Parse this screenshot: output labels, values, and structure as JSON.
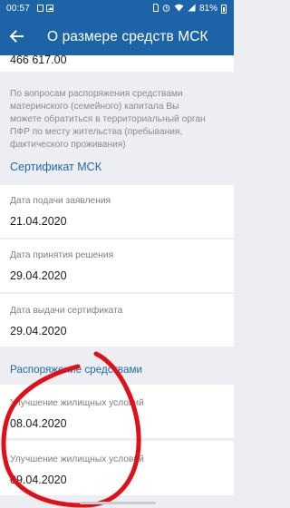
{
  "status_bar": {
    "time": "00:57",
    "battery": "81%",
    "icons": [
      "app-icon",
      "photo-icon",
      "sim-icon",
      "alarm-icon",
      "wifi-icon",
      "signal-icon",
      "battery-icon"
    ]
  },
  "app_bar": {
    "title": "О размере средств МСК",
    "back_icon": "arrow-left-icon"
  },
  "amount": {
    "value": "466 617.00"
  },
  "info": {
    "lines": [
      "По вопросам распоряжения средствами",
      "материнского (семейного) капитала Вы",
      "можете обратиться в территориальный орган",
      "ПФР по месту жительства (пребывания,",
      "фактического проживания)"
    ]
  },
  "certificate": {
    "heading": "Сертификат МСК",
    "fields": [
      {
        "label": "Дата подачи заявления",
        "value": "21.04.2020"
      },
      {
        "label": "Дата принятия решения",
        "value": "29.04.2020"
      },
      {
        "label": "Дата выдачи сертификата",
        "value": "29.04.2020"
      }
    ]
  },
  "disposal": {
    "heading": "Распоряжение средствами",
    "items": [
      {
        "label": "Улучшение жилищных условий",
        "value": "08.04.2020"
      },
      {
        "label": "Улучшение жилищных условий",
        "value": "09.04.2020"
      }
    ]
  },
  "colors": {
    "primary": "#1d63a8",
    "link": "#1f67ad",
    "background": "#eceef1",
    "annotation": "#e0101a"
  }
}
